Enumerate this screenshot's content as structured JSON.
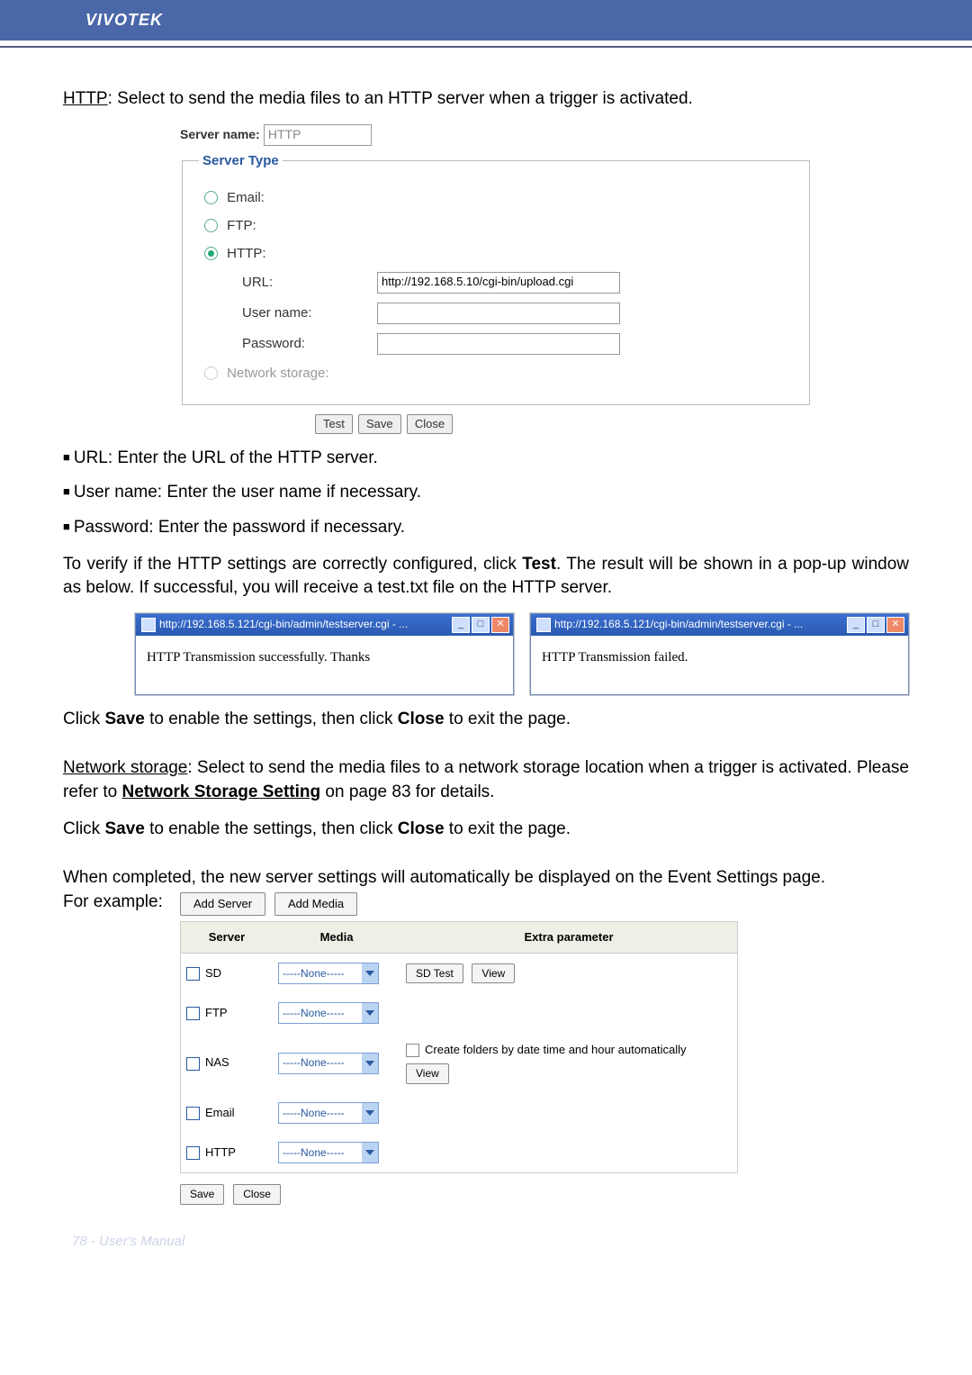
{
  "brand": "VIVOTEK",
  "intro": {
    "http_label": "HTTP",
    "http_desc": ": Select to send the media files to an HTTP server when a trigger is activated."
  },
  "serverbox": {
    "server_name_label": "Server name:",
    "server_name_value": "HTTP",
    "legend": "Server Type",
    "radios": {
      "email": "Email:",
      "ftp": "FTP:",
      "http": "HTTP:",
      "network": "Network storage:"
    },
    "fields": {
      "url_label": "URL:",
      "url_value": "http://192.168.5.10/cgi-bin/upload.cgi",
      "user_label": "User name:",
      "user_value": "",
      "pass_label": "Password:",
      "pass_value": ""
    },
    "buttons": {
      "test": "Test",
      "save": "Save",
      "close": "Close"
    }
  },
  "bullets": {
    "url": "URL: Enter the URL of the HTTP server.",
    "user": "User name: Enter the user name if necessary.",
    "pass": "Password: Enter the password if necessary."
  },
  "verify": {
    "p1a": "To verify if the HTTP settings are correctly configured, click ",
    "test": "Test",
    "p1b": ". The result will be shown in a pop-up window as below. If successful, you will receive a test.txt file on the HTTP server."
  },
  "popups": {
    "title": "http://192.168.5.121/cgi-bin/admin/testserver.cgi - ...",
    "ok_msg": "HTTP Transmission successfully. Thanks",
    "fail_msg": "HTTP Transmission failed."
  },
  "after_popup": {
    "a": "Click ",
    "save": "Save",
    "b": " to enable the settings, then click ",
    "close": "Close",
    "c": " to exit the page."
  },
  "netstorage": {
    "label": "Network storage",
    "desc": ": Select to send the media files to a network storage location when a trigger is activated. Please refer to ",
    "link": "Network Storage Setting",
    "rest": " on page 83 for details."
  },
  "again": {
    "a": "Click ",
    "save": "Save",
    "b": " to enable the settings, then click ",
    "close": "Close",
    "c": " to exit the page."
  },
  "completed": {
    "line1": "When completed, the new server settings will automatically be displayed on the Event Settings page.",
    "line2": "For example:"
  },
  "evt": {
    "tabs": {
      "add_server": "Add Server",
      "add_media": "Add Media"
    },
    "headers": {
      "server": "Server",
      "media": "Media",
      "extra": "Extra parameter"
    },
    "dd_none": "-----None-----",
    "rows": {
      "sd": {
        "name": "SD",
        "btn1": "SD Test",
        "btn2": "View"
      },
      "ftp": {
        "name": "FTP"
      },
      "nas": {
        "name": "NAS",
        "auto": "Create folders by date time and hour automatically",
        "view": "View"
      },
      "email": {
        "name": "Email"
      },
      "http": {
        "name": "HTTP"
      }
    },
    "footer_buttons": {
      "save": "Save",
      "close": "Close"
    }
  },
  "footer": "78 - User's Manual"
}
